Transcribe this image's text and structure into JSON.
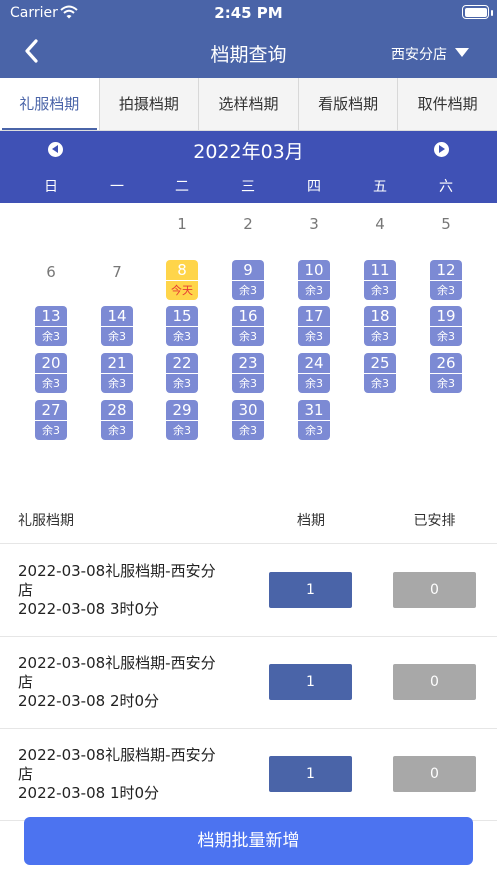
{
  "status_bar": {
    "carrier": "Carrier",
    "time": "2:45 PM"
  },
  "nav": {
    "title": "档期查询",
    "store": "西安分店"
  },
  "tabs": [
    "礼服档期",
    "拍摄档期",
    "选样档期",
    "看版档期",
    "取件档期"
  ],
  "active_tab": 0,
  "calendar": {
    "month_label": "2022年03月",
    "weekdays": [
      "日",
      "一",
      "二",
      "三",
      "四",
      "五",
      "六"
    ],
    "days": [
      {
        "day": "1",
        "col": 2,
        "row": 0
      },
      {
        "day": "2",
        "col": 3,
        "row": 0
      },
      {
        "day": "3",
        "col": 4,
        "row": 0
      },
      {
        "day": "4",
        "col": 5,
        "row": 0
      },
      {
        "day": "5",
        "col": 6,
        "row": 0
      },
      {
        "day": "6",
        "col": 0,
        "row": 1
      },
      {
        "day": "7",
        "col": 1,
        "row": 1
      },
      {
        "day": "8",
        "col": 2,
        "row": 1,
        "today": true,
        "note": "今天"
      },
      {
        "day": "9",
        "col": 3,
        "row": 1,
        "note": "余3"
      },
      {
        "day": "10",
        "col": 4,
        "row": 1,
        "note": "余3"
      },
      {
        "day": "11",
        "col": 5,
        "row": 1,
        "note": "余3"
      },
      {
        "day": "12",
        "col": 6,
        "row": 1,
        "note": "余3"
      },
      {
        "day": "13",
        "col": 0,
        "row": 2,
        "note": "余3"
      },
      {
        "day": "14",
        "col": 1,
        "row": 2,
        "note": "余3"
      },
      {
        "day": "15",
        "col": 2,
        "row": 2,
        "note": "余3"
      },
      {
        "day": "16",
        "col": 3,
        "row": 2,
        "note": "余3"
      },
      {
        "day": "17",
        "col": 4,
        "row": 2,
        "note": "余3"
      },
      {
        "day": "18",
        "col": 5,
        "row": 2,
        "note": "余3"
      },
      {
        "day": "19",
        "col": 6,
        "row": 2,
        "note": "余3"
      },
      {
        "day": "20",
        "col": 0,
        "row": 3,
        "note": "余3"
      },
      {
        "day": "21",
        "col": 1,
        "row": 3,
        "note": "余3"
      },
      {
        "day": "22",
        "col": 2,
        "row": 3,
        "note": "余3"
      },
      {
        "day": "23",
        "col": 3,
        "row": 3,
        "note": "余3"
      },
      {
        "day": "24",
        "col": 4,
        "row": 3,
        "note": "余3"
      },
      {
        "day": "25",
        "col": 5,
        "row": 3,
        "note": "余3"
      },
      {
        "day": "26",
        "col": 6,
        "row": 3,
        "note": "余3"
      },
      {
        "day": "27",
        "col": 0,
        "row": 4,
        "note": "余3"
      },
      {
        "day": "28",
        "col": 1,
        "row": 4,
        "note": "余3"
      },
      {
        "day": "29",
        "col": 2,
        "row": 4,
        "note": "余3"
      },
      {
        "day": "30",
        "col": 3,
        "row": 4,
        "note": "余3"
      },
      {
        "day": "31",
        "col": 4,
        "row": 4,
        "note": "余3"
      }
    ]
  },
  "list": {
    "headers": [
      "礼服档期",
      "档期",
      "已安排"
    ],
    "rows": [
      {
        "title": "2022-03-08礼服档期-西安分店",
        "time": "2022-03-08 3时0分",
        "slots": "1",
        "arranged": "0"
      },
      {
        "title": "2022-03-08礼服档期-西安分店",
        "time": "2022-03-08 2时0分",
        "slots": "1",
        "arranged": "0"
      },
      {
        "title": "2022-03-08礼服档期-西安分店",
        "time": "2022-03-08 1时0分",
        "slots": "1",
        "arranged": "0"
      }
    ]
  },
  "bottom_button": "档期批量新增",
  "colors": {
    "nav_bg": "#4a64a8",
    "calendar_header_bg": "#3f51b5",
    "day_cell": "#7c8ad4",
    "today_cell": "#ffd54a",
    "slot_button": "#4a64a8",
    "arranged_button": "#a8a8a8",
    "bottom_button": "#4c73f0"
  },
  "icons": {
    "back": "chevron-left-icon",
    "store_dropdown": "caret-down-icon",
    "wifi": "wifi-icon",
    "battery": "battery-icon",
    "prev_month": "chevron-left-circle-icon",
    "next_month": "chevron-right-circle-icon"
  }
}
